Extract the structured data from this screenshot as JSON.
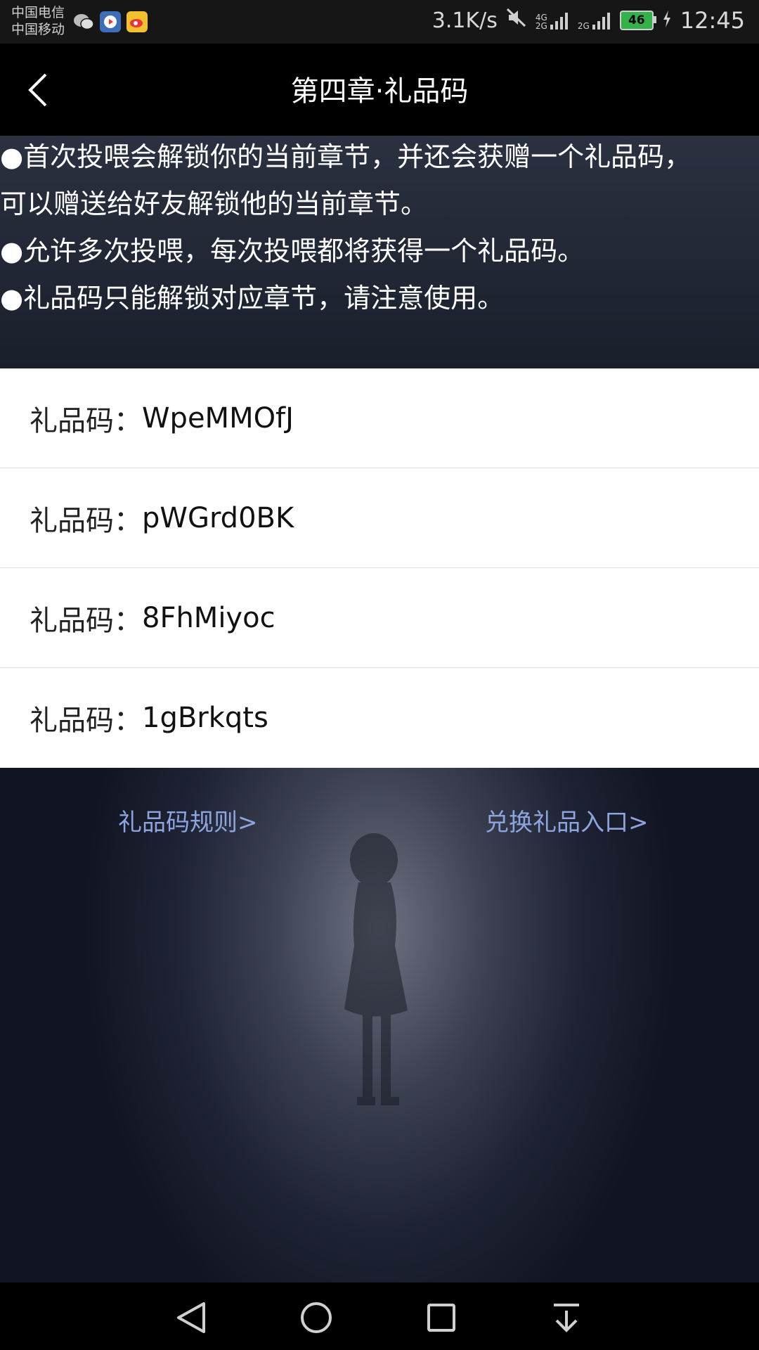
{
  "status_bar": {
    "carrier_1": "中国电信",
    "carrier_2": "中国移动",
    "net_speed": "3.1K/s",
    "signal_1_label": "4G\n2G",
    "signal_2_label": "2G",
    "battery_level": "46",
    "time": "12:45"
  },
  "header": {
    "title": "第四章·礼品码"
  },
  "rules": [
    "●首次投喂会解锁你的当前章节，并还会获赠一个礼品码，可以赠送给好友解锁他的当前章节。",
    "●允许多次投喂，每次投喂都将获得一个礼品码。",
    "●礼品码只能解锁对应章节，请注意使用。"
  ],
  "codes": [
    {
      "label": "礼品码：",
      "value": "WpeMMOfJ"
    },
    {
      "label": "礼品码：",
      "value": "pWGrd0BK"
    },
    {
      "label": "礼品码：",
      "value": "8FhMiyoc"
    },
    {
      "label": "礼品码：",
      "value": "1gBrkqts"
    }
  ],
  "links": {
    "rules": "礼品码规则>",
    "redeem": "兑换礼品入口>"
  },
  "colors": {
    "link": "#8ea4e0",
    "header_bg": "#000000",
    "battery": "#33b24a"
  }
}
